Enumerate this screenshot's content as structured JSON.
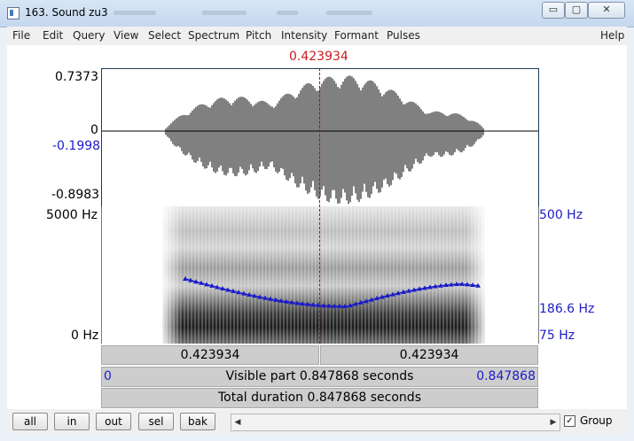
{
  "window": {
    "title": "163. Sound zu3",
    "close_label": "✕",
    "minimize_label": "▭",
    "maximize_label": "▢"
  },
  "menu": [
    "File",
    "Edit",
    "Query",
    "View",
    "Select",
    "Spectrum",
    "Pitch",
    "Intensity",
    "Formant",
    "Pulses"
  ],
  "help_label": "Help",
  "cursor_time": "0.423934",
  "waveform": {
    "max_label": "0.7373",
    "zero_label": "0",
    "cursor_value_label": "-0.1998",
    "min_label": "-0.8983"
  },
  "spectrogram": {
    "top_label": "5000 Hz",
    "bottom_label": "0 Hz",
    "pitch_top_label": "500 Hz",
    "pitch_cursor_label": "186.6 Hz",
    "pitch_bottom_label": "75 Hz"
  },
  "bars": {
    "left_segment": "0.423934",
    "right_segment": "0.423934",
    "visible_start": "0",
    "visible_text": "Visible part 0.847868 seconds",
    "visible_end": "0.847868",
    "total_text": "Total duration 0.847868 seconds"
  },
  "buttons": {
    "all": "all",
    "in": "in",
    "out": "out",
    "sel": "sel",
    "bak": "bak"
  },
  "scroll": {
    "left_arrow": "◀",
    "right_arrow": "▶"
  },
  "group": {
    "label": "Group",
    "checked": true,
    "check_mark": "✓"
  },
  "colors": {
    "cursor": "#cc1c1c",
    "pitch": "#1c1cc8",
    "waveform": "#000000"
  }
}
